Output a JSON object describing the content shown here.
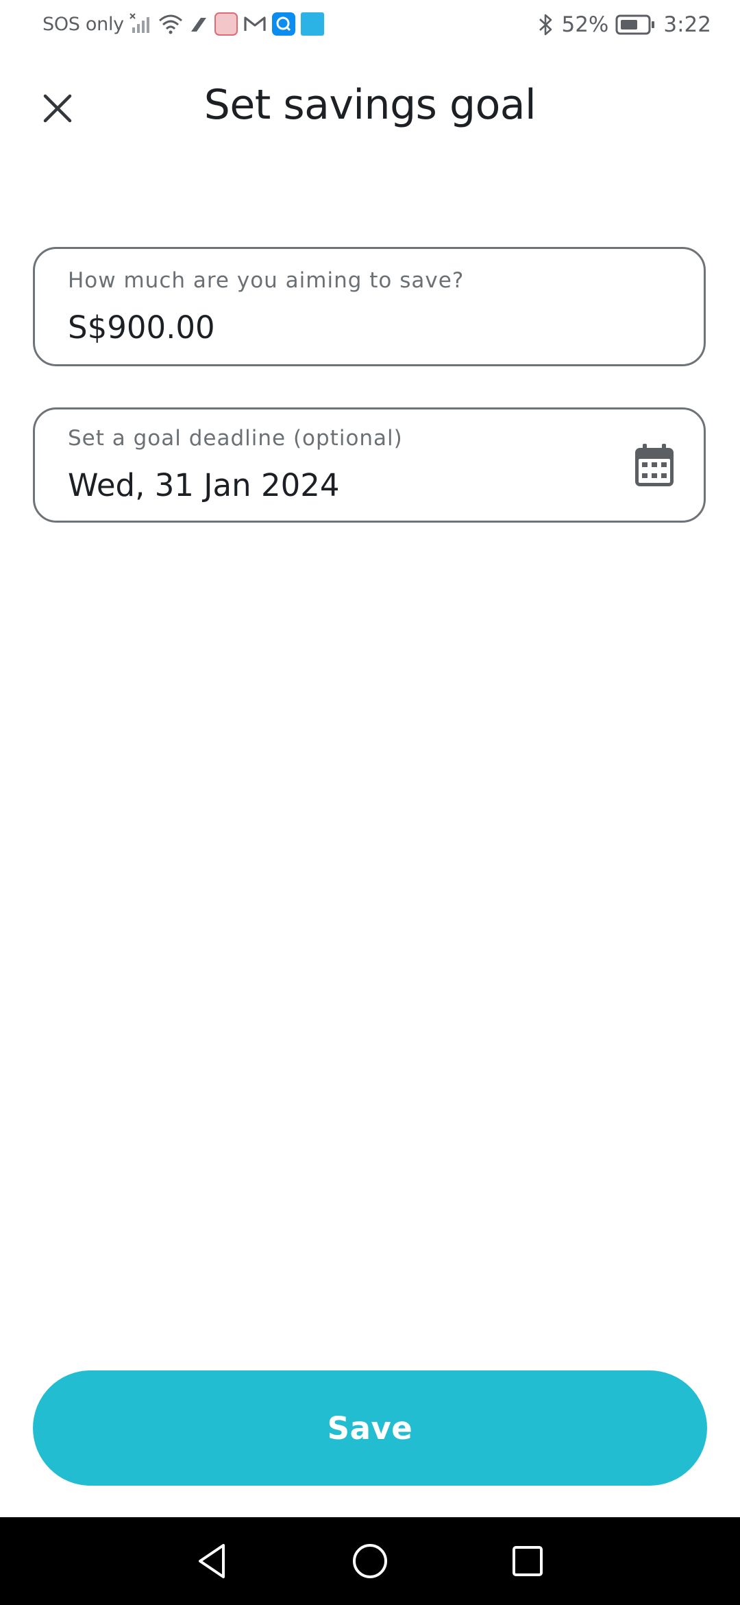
{
  "status_bar": {
    "carrier": "SOS only",
    "battery": "52%",
    "time": "3:22",
    "icons": [
      "signal-icon",
      "wifi-icon",
      "data-icon",
      "app-notification-icon",
      "gmail-icon",
      "search-app-icon",
      "app-icon",
      "bluetooth-icon",
      "battery-icon"
    ]
  },
  "header": {
    "title": "Set savings goal",
    "close_icon": "close-icon"
  },
  "form": {
    "amount": {
      "label": "How much are you aiming to save?",
      "value": "S$900.00"
    },
    "deadline": {
      "label": "Set a goal deadline (optional)",
      "value": "Wed, 31 Jan 2024",
      "icon": "calendar-icon"
    }
  },
  "actions": {
    "save_label": "Save"
  },
  "colors": {
    "accent": "#23bdd2",
    "border": "#6e7378",
    "text": "#1c1f23",
    "label": "#6b7075"
  },
  "nav": {
    "back_icon": "back-triangle-icon",
    "home_icon": "home-circle-icon",
    "recents_icon": "recents-square-icon"
  }
}
